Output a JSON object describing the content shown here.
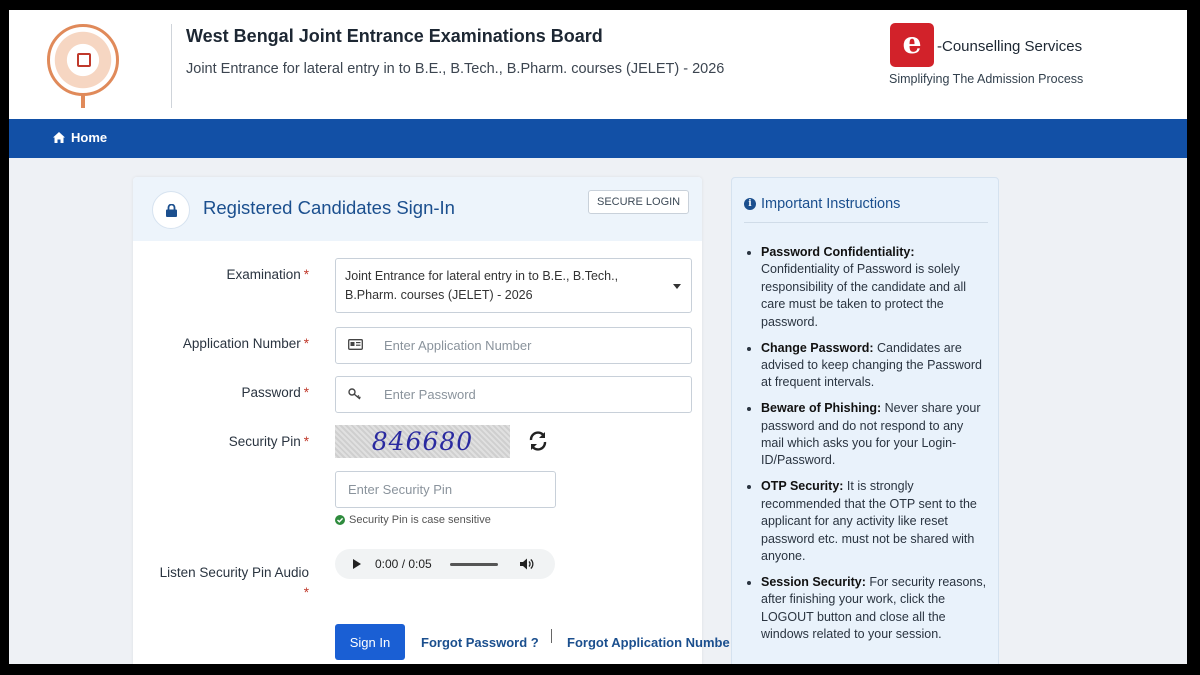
{
  "header": {
    "org_name": "West Bengal Joint Entrance Examinations Board",
    "subtitle": "Joint Entrance for lateral entry in to B.E., B.Tech., B.Pharm. courses (JELET) - 2026",
    "ecounselling_name": "-Counselling Services",
    "ecounselling_tagline": "Simplifying The Admission Process",
    "ecounselling_icon_letter": "e"
  },
  "nav": {
    "home_label": "Home"
  },
  "signin": {
    "title": "Registered Candidates Sign-In",
    "secure_badge": "SECURE LOGIN",
    "examination_label": "Examination",
    "examination_value": "Joint Entrance for lateral entry in to B.E., B.Tech., B.Pharm. courses (JELET) - 2026",
    "application_label": "Application Number",
    "application_placeholder": "Enter Application Number",
    "password_label": "Password",
    "password_placeholder": "Enter Password",
    "security_pin_label": "Security Pin",
    "captcha_text": "846680",
    "security_pin_placeholder": "Enter Security Pin",
    "case_hint": "Security Pin is case sensitive",
    "audio_label": "Listen Security Pin Audio",
    "audio_time": "0:00 / 0:05",
    "required_marker": "*",
    "signin_button": "Sign In",
    "forgot_password": "Forgot Password ?",
    "forgot_application": "Forgot Application Numbe"
  },
  "instructions": {
    "title": "Important Instructions",
    "items": [
      {
        "heading": "Password Confidentiality:",
        "text": "Confidentiality of Password is solely responsibility of the candidate and all care must be taken to protect the password."
      },
      {
        "heading": "Change Password:",
        "text": "Candidates are advised to keep changing the Password at frequent intervals."
      },
      {
        "heading": "Beware of Phishing:",
        "text": "Never share your password and do not respond to any mail which asks you for your Login-ID/Password."
      },
      {
        "heading": "OTP Security:",
        "text": "It is strongly recommended that the OTP sent to the applicant for any activity like reset password etc. must not be shared with anyone."
      },
      {
        "heading": "Session Security:",
        "text": "For security reasons, after finishing your work, click the LOGOUT button and close all the windows related to your session."
      }
    ]
  },
  "colors": {
    "nav_blue": "#1250a6",
    "title_blue": "#1b4f8e",
    "button_blue": "#1a5fd4",
    "required_red": "#c0392b",
    "brand_red": "#d2222a"
  },
  "icons": [
    "lock-icon",
    "home-icon",
    "id-card-icon",
    "key-icon",
    "refresh-icon",
    "check-circle-icon",
    "info-icon",
    "play-icon",
    "volume-icon",
    "caret-down-icon"
  ]
}
